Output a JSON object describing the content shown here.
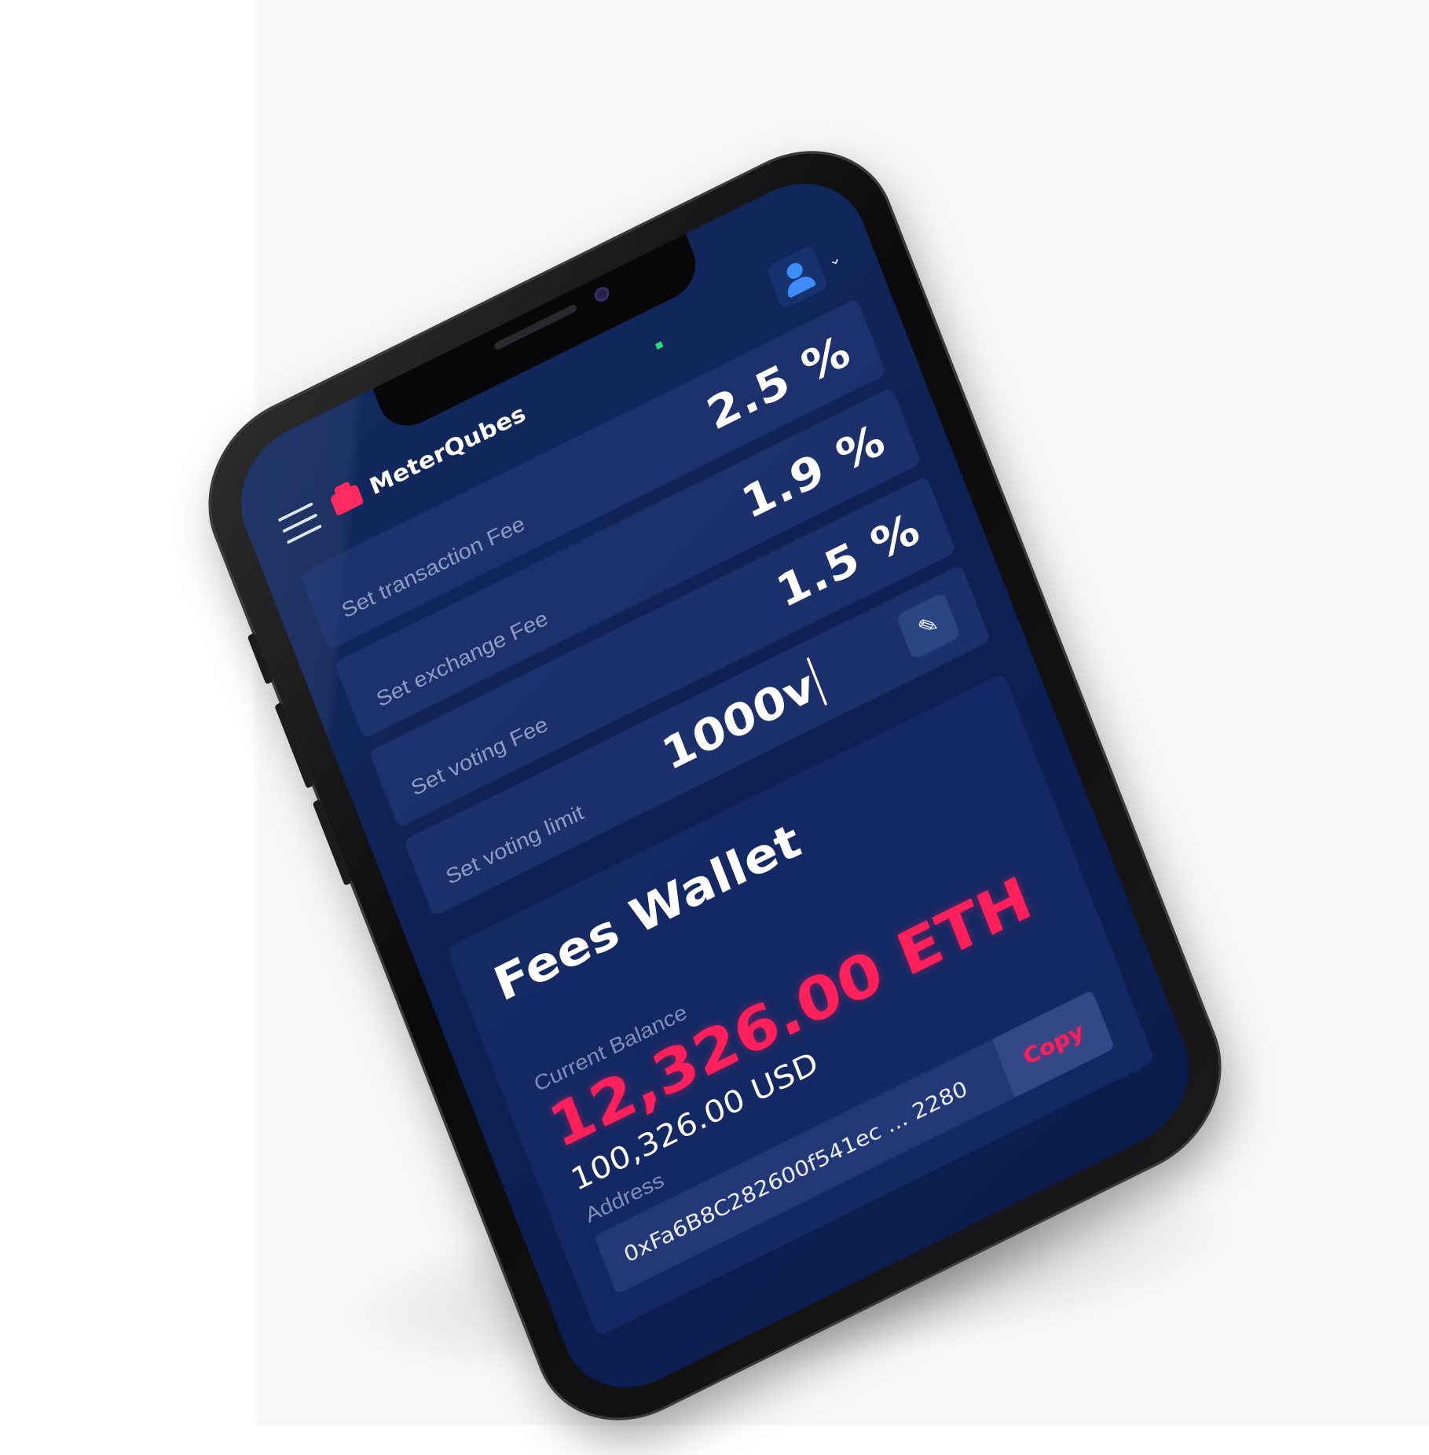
{
  "app": {
    "brand": "MeterQubes"
  },
  "settings": [
    {
      "label": "Set transaction Fee",
      "value": "2.5 %"
    },
    {
      "label": "Set exchange Fee",
      "value": "1.9 %"
    },
    {
      "label": "Set voting Fee",
      "value": "1.5 %"
    },
    {
      "label": "Set voting limit",
      "value": "1000v"
    }
  ],
  "wallet": {
    "title": "Fees Wallet",
    "balance_label": "Current Balance",
    "balance_eth": "12,326.00 ETH",
    "balance_usd": "100,326.00 USD",
    "address_label": "Address",
    "address": "0xFa6B8C282600f541ec ... 2280",
    "copy_label": "Copy"
  },
  "colors": {
    "screen_bg": "#0e2155",
    "accent": "#ff1f5a",
    "brand_mark": "#ff2a5f",
    "avatar_icon": "#3f8cff",
    "status_dot": "#29e06e"
  },
  "icons": {
    "menu": "hamburger-menu-icon",
    "logo": "meterqubes-logo-icon",
    "avatar": "user-avatar-icon",
    "dropdown": "chevron-down-icon",
    "edit": "pencil-icon"
  }
}
